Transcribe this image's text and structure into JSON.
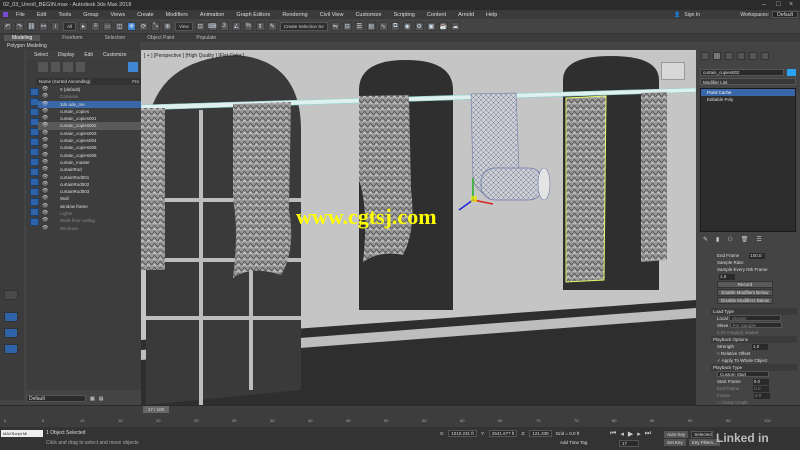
{
  "window": {
    "title": "02_03_Unroll_BEGIN.max - Autodesk 3ds Max 2018"
  },
  "menu": [
    "File",
    "Edit",
    "Tools",
    "Group",
    "Views",
    "Create",
    "Modifiers",
    "Animation",
    "Graph Editors",
    "Rendering",
    "Civil View",
    "Customize",
    "Scripting",
    "Content",
    "Arnold",
    "Help"
  ],
  "account": {
    "signin": "Sign In",
    "workspaces_label": "Workspaces:",
    "workspace": "Default"
  },
  "toolbar": {
    "filter": "All",
    "view": "View",
    "selection_set": "Create Selection Se"
  },
  "ribbon": {
    "tabs": [
      "Modeling",
      "Freeform",
      "Selection",
      "Object Paint",
      "Populate"
    ],
    "sub": "Polygon Modeling"
  },
  "scene_explorer": {
    "tabs": [
      "Select",
      "Display",
      "Edit",
      "Customize"
    ],
    "header": "Name (Sorted Ascending)",
    "header_right": "Fro",
    "rows": [
      {
        "name": "0 (default)",
        "style": ""
      },
      {
        "name": "Cameras",
        "style": "dim"
      },
      {
        "name": "3ds ade_me",
        "style": "hlt"
      },
      {
        "name": "curtain_copies",
        "style": ""
      },
      {
        "name": "curtain_copies001",
        "style": ""
      },
      {
        "name": "curtain_copies002",
        "style": "sel"
      },
      {
        "name": "curtain_copies003",
        "style": ""
      },
      {
        "name": "curtain_copies004",
        "style": ""
      },
      {
        "name": "curtain_copies005",
        "style": ""
      },
      {
        "name": "curtain_copies006",
        "style": ""
      },
      {
        "name": "curtain_master",
        "style": ""
      },
      {
        "name": "curtainRod",
        "style": ""
      },
      {
        "name": "curtainRod001",
        "style": ""
      },
      {
        "name": "curtainRod002",
        "style": ""
      },
      {
        "name": "curtainRod003",
        "style": ""
      },
      {
        "name": "Wall",
        "style": ""
      },
      {
        "name": "window frame",
        "style": ""
      },
      {
        "name": "Lights",
        "style": "dim"
      },
      {
        "name": "Walls floor ceiling",
        "style": "dim"
      },
      {
        "name": "Windows",
        "style": "dim"
      }
    ],
    "layer": "Default"
  },
  "viewport": {
    "label": "[ + ] [Perspective ] [High Quality ] [Flat Color ]",
    "watermark": "www.cgtsj.com"
  },
  "command_panel": {
    "object_name": "curtain_copies002",
    "object_color": "#2aa3f5",
    "modifier_list": "Modifier List",
    "stack": [
      "Point Cache",
      "Editable Poly"
    ],
    "params": {
      "end_frame_label": "End Frame",
      "end_frame": "100.0",
      "sample_rate_label": "Sample Rate:",
      "sample_every_label": "Sample Every Nth Frame",
      "sample_every": "1.0",
      "record": "Record",
      "enable_mods": "Enable Modifiers Below",
      "disable_mods": "Disable Modifiers Below",
      "load_type": "Load Type",
      "local": "Local",
      "local_value": "Stream",
      "slave": "Slave",
      "slave_value": "Per Sample",
      "load_hint": "0.00 mega(s) loaded",
      "playback_options": "Playback Options",
      "strength_label": "Strength",
      "strength": "1.0",
      "relative_offset": "Relative Offset",
      "apply_whole": "Apply To Whole Object",
      "playback_type": "Playback Type",
      "playback_value": "Custom Start",
      "start_frame_label": "Start Frame",
      "start_frame": "0.0",
      "end_frame2_label": "End Frame",
      "end_frame2": "0.0",
      "frame_label": "Frame",
      "frame_value": "0.0",
      "clamp": "Clamp Graph"
    }
  },
  "timeline": {
    "slider": "17 / 100",
    "ticks": [
      "0",
      "5",
      "10",
      "15",
      "20",
      "25",
      "30",
      "35",
      "40",
      "45",
      "50",
      "55",
      "60",
      "65",
      "70",
      "75",
      "80",
      "85",
      "90",
      "95",
      "100"
    ]
  },
  "status": {
    "maxscript": "MAXScript Mi",
    "line1": "1 Object Selected",
    "line2": "Click and drag to select and move objects",
    "x": "1010.231 ft",
    "y": "2541.677 ft",
    "z": "121.338",
    "grid": "Grid = 0.0 ft",
    "add_time_tag": "Add Time Tag",
    "frame": "17",
    "auto_key": "Auto Key",
    "set_key": "Set Key",
    "key_selected": "Selected",
    "key_filters": "Key Filters...",
    "brand": "Linked in"
  }
}
